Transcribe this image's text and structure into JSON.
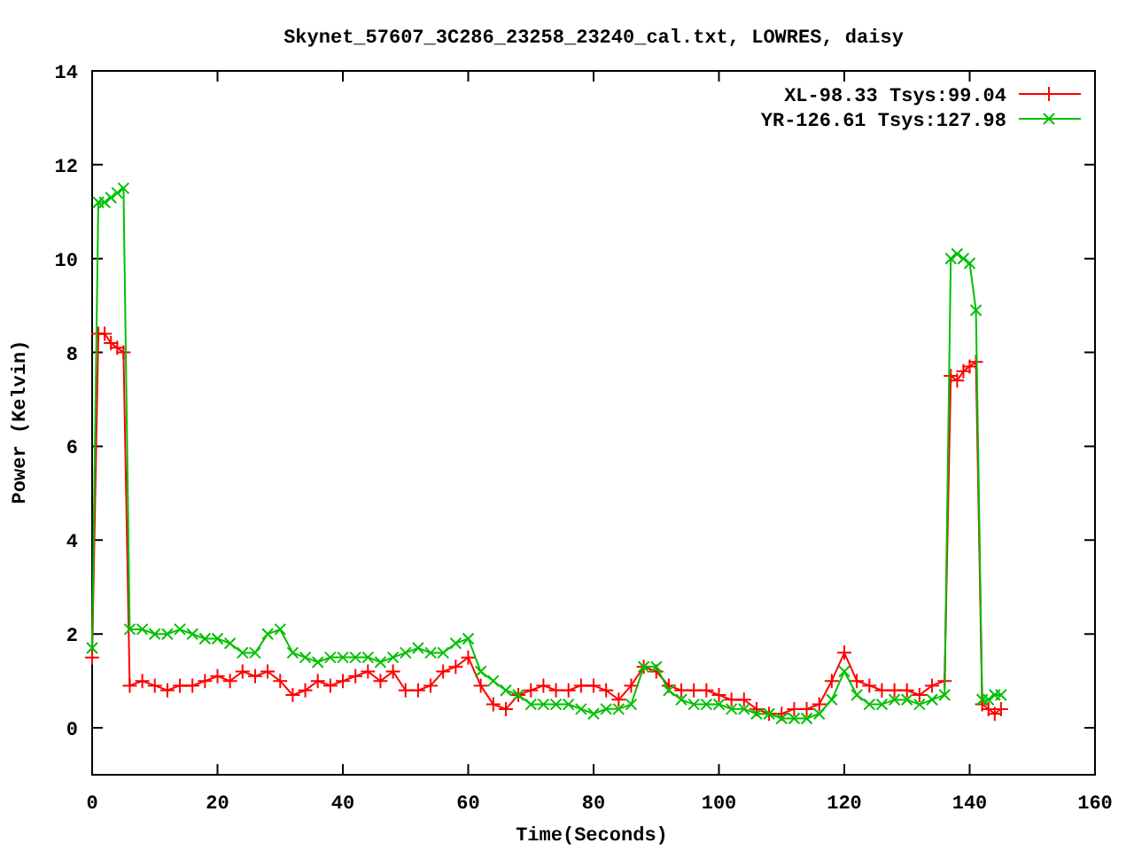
{
  "chart_data": {
    "type": "line",
    "title": "Skynet_57607_3C286_23258_23240_cal.txt, LOWRES, daisy",
    "xlabel": "Time(Seconds)",
    "ylabel": "Power (Kelvin)",
    "xlim": [
      0,
      160
    ],
    "ylim": [
      -1,
      14
    ],
    "xticks": [
      0,
      20,
      40,
      60,
      80,
      100,
      120,
      140,
      160
    ],
    "yticks": [
      0,
      2,
      4,
      6,
      8,
      10,
      12,
      14
    ],
    "legend": "top-right",
    "x": [
      0,
      1,
      2,
      3,
      4,
      5,
      6,
      8,
      10,
      12,
      14,
      16,
      18,
      20,
      22,
      24,
      26,
      28,
      30,
      32,
      34,
      36,
      38,
      40,
      42,
      44,
      46,
      48,
      50,
      52,
      54,
      56,
      58,
      60,
      62,
      64,
      66,
      68,
      70,
      72,
      74,
      76,
      78,
      80,
      82,
      84,
      86,
      88,
      90,
      92,
      94,
      96,
      98,
      100,
      102,
      104,
      106,
      108,
      110,
      112,
      114,
      116,
      118,
      120,
      122,
      124,
      126,
      128,
      130,
      132,
      134,
      136,
      137,
      138,
      139,
      140,
      141,
      142,
      143,
      144,
      145
    ],
    "series": [
      {
        "name": "XL-98.33 Tsys:99.04",
        "color": "#ff0000",
        "marker": "plus",
        "values": [
          1.5,
          8.4,
          8.4,
          8.2,
          8.1,
          8.0,
          0.9,
          1.0,
          0.9,
          0.8,
          0.9,
          0.9,
          1.0,
          1.1,
          1.0,
          1.2,
          1.1,
          1.2,
          1.0,
          0.7,
          0.8,
          1.0,
          0.9,
          1.0,
          1.1,
          1.2,
          1.0,
          1.2,
          0.8,
          0.8,
          0.9,
          1.2,
          1.3,
          1.5,
          0.9,
          0.5,
          0.4,
          0.7,
          0.8,
          0.9,
          0.8,
          0.8,
          0.9,
          0.9,
          0.8,
          0.6,
          0.9,
          1.3,
          1.2,
          0.9,
          0.8,
          0.8,
          0.8,
          0.7,
          0.6,
          0.6,
          0.4,
          0.3,
          0.3,
          0.4,
          0.4,
          0.5,
          1.0,
          1.6,
          1.0,
          0.9,
          0.8,
          0.8,
          0.8,
          0.7,
          0.9,
          1.0,
          7.5,
          7.4,
          7.6,
          7.7,
          7.8,
          0.5,
          0.4,
          0.3,
          0.4
        ]
      },
      {
        "name": "YR-126.61 Tsys:127.98",
        "color": "#00c000",
        "marker": "cross",
        "values": [
          1.7,
          11.2,
          11.2,
          11.3,
          11.4,
          11.5,
          2.1,
          2.1,
          2.0,
          2.0,
          2.1,
          2.0,
          1.9,
          1.9,
          1.8,
          1.6,
          1.6,
          2.0,
          2.1,
          1.6,
          1.5,
          1.4,
          1.5,
          1.5,
          1.5,
          1.5,
          1.4,
          1.5,
          1.6,
          1.7,
          1.6,
          1.6,
          1.8,
          1.9,
          1.2,
          1.0,
          0.8,
          0.7,
          0.5,
          0.5,
          0.5,
          0.5,
          0.4,
          0.3,
          0.4,
          0.4,
          0.5,
          1.3,
          1.3,
          0.8,
          0.6,
          0.5,
          0.5,
          0.5,
          0.4,
          0.4,
          0.3,
          0.3,
          0.2,
          0.2,
          0.2,
          0.3,
          0.6,
          1.2,
          0.7,
          0.5,
          0.5,
          0.6,
          0.6,
          0.5,
          0.6,
          0.7,
          10.0,
          10.1,
          10.0,
          9.9,
          8.9,
          0.6,
          0.6,
          0.7,
          0.7
        ]
      }
    ]
  }
}
